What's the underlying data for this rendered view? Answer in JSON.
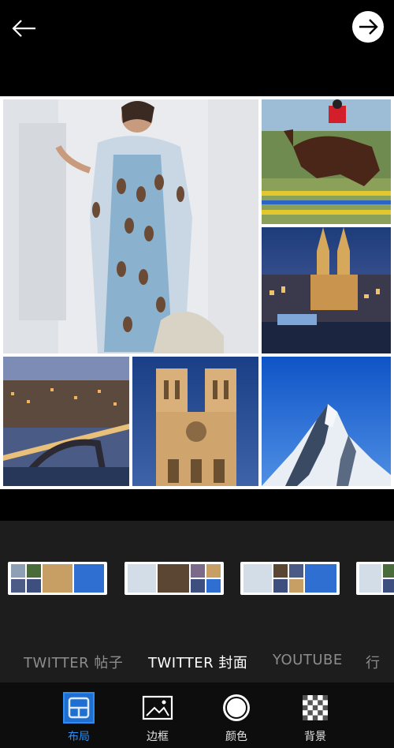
{
  "header": {
    "back_icon": "arrow-left-icon",
    "next_icon": "arrow-right-circle-icon"
  },
  "collage": {
    "photos": [
      "fashion-woman-photo",
      "horse-jumping-photo",
      "cologne-cathedral-night-photo",
      "porto-bridge-night-photo",
      "notre-dame-photo",
      "matterhorn-photo"
    ]
  },
  "layout_strip": {
    "thumbnails": [
      "layout-thumb-1",
      "layout-thumb-2",
      "layout-thumb-3",
      "layout-thumb-4"
    ]
  },
  "tabs": [
    {
      "label": "TWITTER 帖子",
      "active": false
    },
    {
      "label": "TWITTER 封面",
      "active": true
    },
    {
      "label": "YOUTUBE",
      "active": false
    },
    {
      "label": "行",
      "active": false
    }
  ],
  "toolbar": {
    "items": [
      {
        "label": "布局",
        "icon": "layout-grid-icon",
        "active": true
      },
      {
        "label": "边框",
        "icon": "image-frame-icon",
        "active": false
      },
      {
        "label": "颜色",
        "icon": "color-circle-icon",
        "active": false
      },
      {
        "label": "背景",
        "icon": "checkerboard-icon",
        "active": false
      }
    ]
  },
  "colors": {
    "accent": "#2f8df0",
    "panel": "#1d1d1d",
    "toolbar": "#0d0d0d",
    "tab_inactive": "#8c8c8c"
  }
}
